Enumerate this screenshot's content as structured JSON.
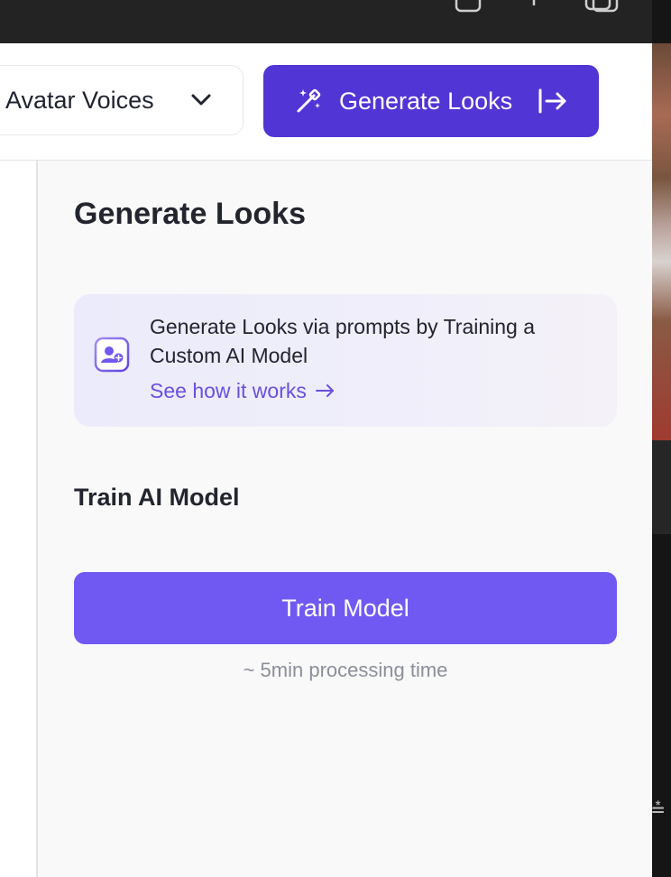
{
  "header": {
    "voices_select": {
      "label": "Avatar Voices"
    },
    "generate_button": {
      "label": "Generate Looks"
    }
  },
  "panel": {
    "title": "Generate Looks",
    "info_card": {
      "text": "Generate Looks via prompts by Training a Custom AI Model",
      "link": "See how it works"
    },
    "section_title": "Train AI Model",
    "train_button": {
      "label": "Train Model"
    },
    "processing_note": "~ 5min processing time"
  },
  "colors": {
    "primary_button": "#5235d5",
    "train_button": "#7059f3",
    "link": "#6b4fe0",
    "topbar": "#232323",
    "panel_bg": "#f9f9f9"
  },
  "icons": {
    "wand": "magic-wand-icon",
    "exit": "arrow-right-to-line-icon",
    "chevron": "chevron-down-icon",
    "user_add": "user-square-icon",
    "link_arrow": "arrow-right-icon"
  }
}
